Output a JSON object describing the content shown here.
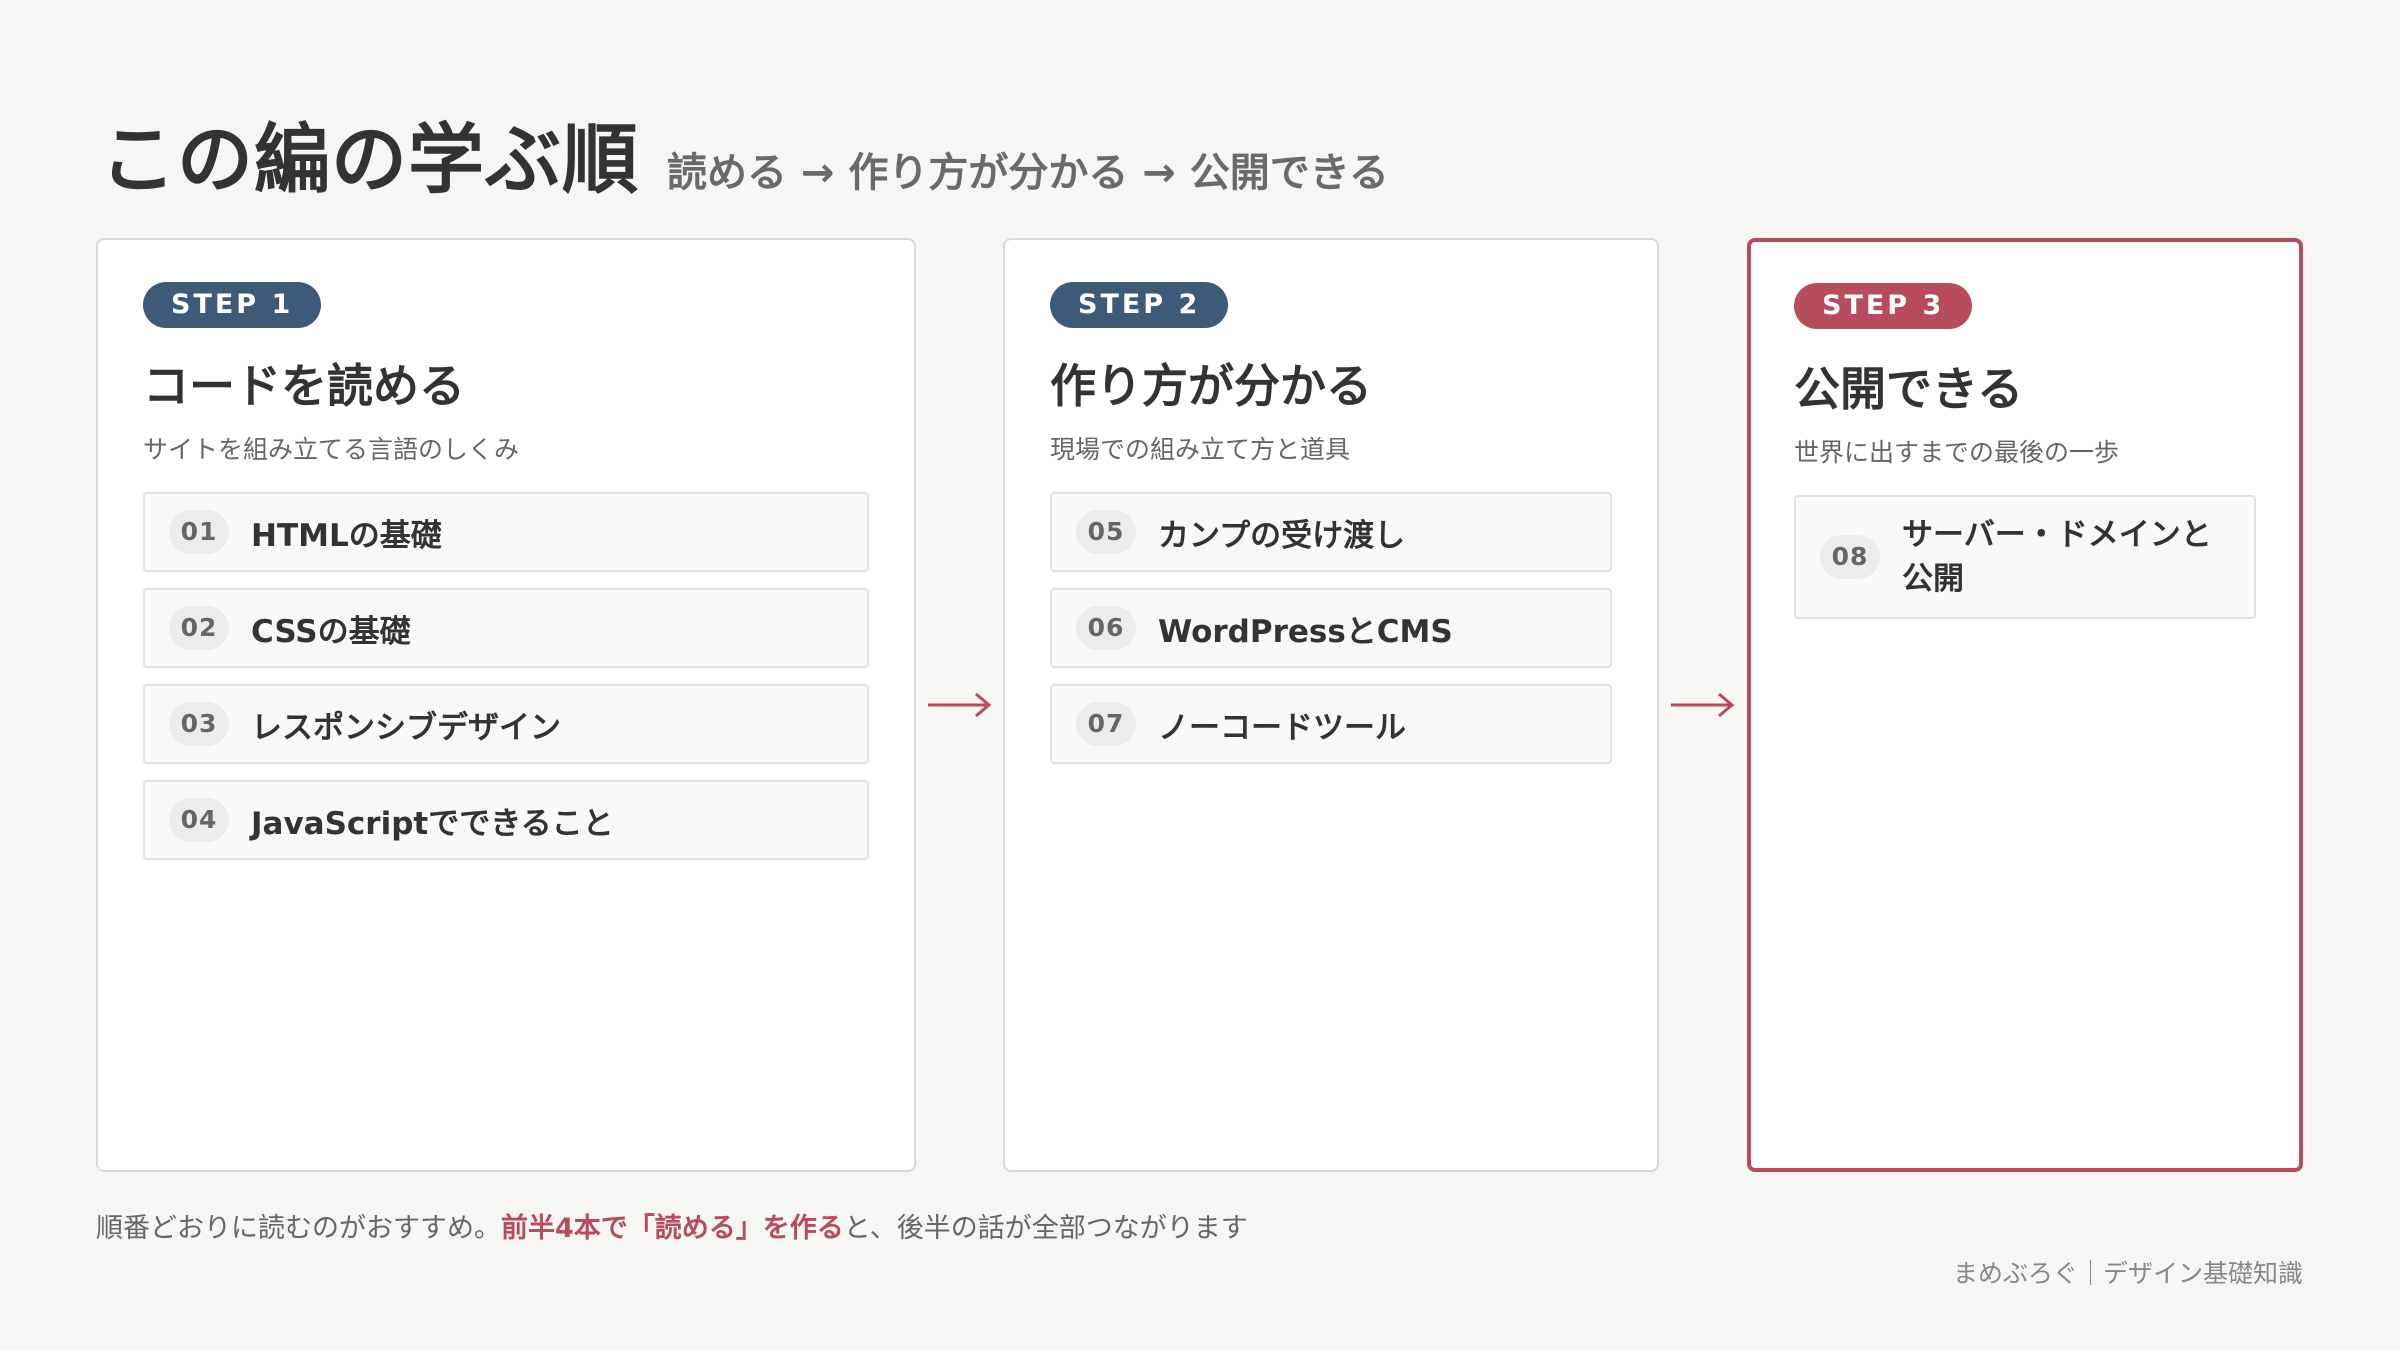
{
  "header": {
    "title": "この編の学ぶ順",
    "subtitle": "読める → 作り方が分かる → 公開できる"
  },
  "colors": {
    "accent_blue": "#3d5a78",
    "accent_red": "#b64c5c",
    "background": "#f6f6f4"
  },
  "steps": [
    {
      "badge": "STEP 1",
      "title": "コードを読める",
      "description": "サイトを組み立てる言語のしくみ",
      "items": [
        {
          "num": "01",
          "label": "HTMLの基礎"
        },
        {
          "num": "02",
          "label": "CSSの基礎"
        },
        {
          "num": "03",
          "label": "レスポンシブデザイン"
        },
        {
          "num": "04",
          "label": "JavaScriptでできること"
        }
      ]
    },
    {
      "badge": "STEP 2",
      "title": "作り方が分かる",
      "description": "現場での組み立て方と道具",
      "items": [
        {
          "num": "05",
          "label": "カンプの受け渡し"
        },
        {
          "num": "06",
          "label": "WordPressとCMS"
        },
        {
          "num": "07",
          "label": "ノーコードツール"
        }
      ]
    },
    {
      "badge": "STEP 3",
      "title": "公開できる",
      "description": "世界に出すまでの最後の一歩",
      "items": [
        {
          "num": "08",
          "label": "サーバー・ドメインと公開"
        }
      ]
    }
  ],
  "note": {
    "before": "順番どおりに読むのがおすすめ。",
    "highlight": "前半4本で「読める」を作る",
    "after": "と、後半の話が全部つながります"
  },
  "footer": "まめぶろぐ｜デザイン基礎知識"
}
